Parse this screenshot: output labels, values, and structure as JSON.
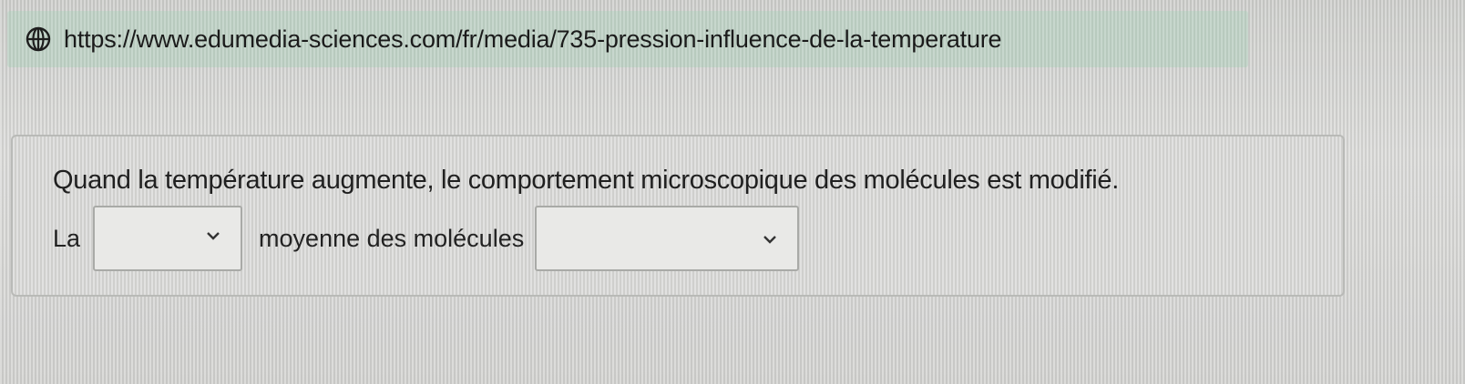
{
  "browser": {
    "url": "https://www.edumedia-sciences.com/fr/media/735-pression-influence-de-la-temperature",
    "icon": "globe-icon"
  },
  "question": {
    "statement": "Quand la température augmente, le comportement microscopique des molécules est modifié.",
    "sentence_part_1": "La",
    "select_1_value": "",
    "sentence_part_2": "moyenne des molécules",
    "select_2_value": "",
    "select_icon": "chevron-down-icon"
  }
}
